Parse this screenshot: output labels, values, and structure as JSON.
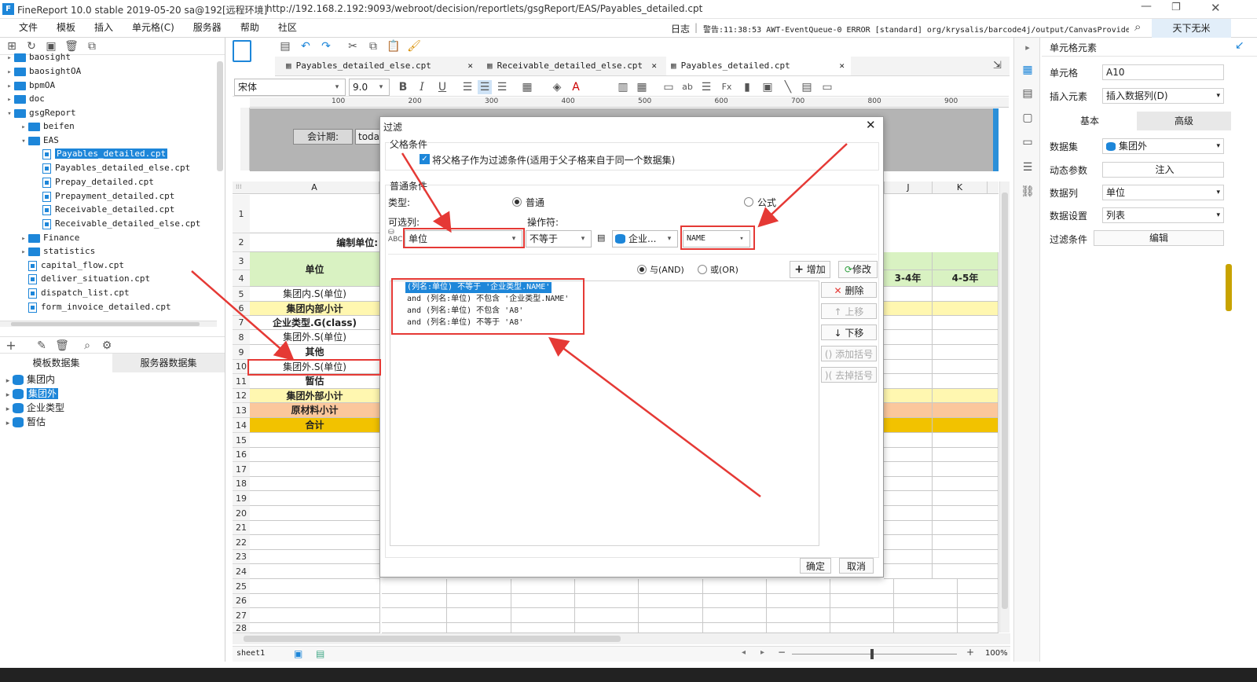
{
  "window": {
    "title": "FineReport 10.0 stable 2019-05-20 sa@192[远程环境]",
    "url": "http://192.168.2.192:9093/webroot/decision/reportlets/gsgReport/EAS/Payables_detailed.cpt",
    "user": "天下无米"
  },
  "menu": [
    "文件",
    "模板",
    "插入",
    "单元格(C)",
    "服务器",
    "帮助",
    "社区"
  ],
  "log": {
    "label": "日志",
    "warning": "警告:11:38:53 AWT-EventQueue-0 ERROR [standard] org/krysalis/barcode4j/output/CanvasProvider"
  },
  "tree": [
    {
      "label": "baosight",
      "type": "folder",
      "depth": 0
    },
    {
      "label": "baosightOA",
      "type": "folder",
      "depth": 0
    },
    {
      "label": "bpmOA",
      "type": "folder",
      "depth": 0
    },
    {
      "label": "doc",
      "type": "folder",
      "depth": 0
    },
    {
      "label": "gsgReport",
      "type": "folder",
      "depth": 0,
      "open": true
    },
    {
      "label": "beifen",
      "type": "folder",
      "depth": 1
    },
    {
      "label": "EAS",
      "type": "folder",
      "depth": 1,
      "open": true
    },
    {
      "label": "Payables_detailed.cpt",
      "type": "file",
      "depth": 2,
      "selected": true
    },
    {
      "label": "Payables_detailed_else.cpt",
      "type": "file",
      "depth": 2
    },
    {
      "label": "Prepay_detailed.cpt",
      "type": "file",
      "depth": 2
    },
    {
      "label": "Prepayment_detailed.cpt",
      "type": "file",
      "depth": 2
    },
    {
      "label": "Receivable_detailed.cpt",
      "type": "file",
      "depth": 2
    },
    {
      "label": "Receivable_detailed_else.cpt",
      "type": "file",
      "depth": 2
    },
    {
      "label": "Finance",
      "type": "folder",
      "depth": 1
    },
    {
      "label": "statistics",
      "type": "folder",
      "depth": 1
    },
    {
      "label": "capital_flow.cpt",
      "type": "file",
      "depth": 1
    },
    {
      "label": "deliver_situation.cpt",
      "type": "file",
      "depth": 1
    },
    {
      "label": "dispatch_list.cpt",
      "type": "file",
      "depth": 1
    },
    {
      "label": "form_invoice_detailed.cpt",
      "type": "file",
      "depth": 1
    }
  ],
  "dataset_tabs": [
    "模板数据集",
    "服务器数据集"
  ],
  "datasets": [
    {
      "label": "集团内"
    },
    {
      "label": "集团外",
      "selected": true
    },
    {
      "label": "企业类型"
    },
    {
      "label": "暂估"
    }
  ],
  "tabs": [
    {
      "label": "Payables_detailed_else.cpt"
    },
    {
      "label": "Receivable_detailed_else.cpt"
    },
    {
      "label": "Payables_detailed.cpt",
      "active": true
    }
  ],
  "format": {
    "font": "宋体",
    "size": "9.0"
  },
  "ruler": [
    "100",
    "200",
    "300",
    "400",
    "500",
    "600",
    "700",
    "800",
    "900"
  ],
  "param": {
    "label": "会计期:",
    "value": "toda"
  },
  "sheet": {
    "col_a": "A",
    "col_j": "J",
    "col_k": "K",
    "rows": [
      "1",
      "2",
      "3",
      "4",
      "5",
      "6",
      "7",
      "8",
      "9",
      "10",
      "11",
      "12",
      "13",
      "14",
      "15",
      "16",
      "17",
      "18",
      "19",
      "20",
      "21",
      "22",
      "23",
      "24",
      "25",
      "26",
      "27",
      "28"
    ],
    "cells": {
      "r2": "编制单位:",
      "unit": "单位",
      "r5": "集团内.S(单位)",
      "r6": "集团内部小计",
      "r7": "企业类型.G(class)",
      "r8": "集团外.S(单位)",
      "r9": "其他",
      "r10": "集团外.S(单位)",
      "r11": "暂估",
      "r12": "集团外部小计",
      "r13": "原材料小计",
      "r14": "合计",
      "j4": "3-4年",
      "k4": "4-5年"
    },
    "tab": "sheet1",
    "zoom": "100%"
  },
  "dialog": {
    "title": "过滤",
    "parent_section": "父格条件",
    "parent_checkbox": "将父格子作为过滤条件(适用于父子格来自于同一个数据集)",
    "normal_section": "普通条件",
    "type_label": "类型:",
    "type_normal": "普通",
    "type_formula": "公式",
    "column_label": "可选列:",
    "operator_label": "操作符:",
    "column_value": "单位",
    "operator_value": "不等于",
    "dataset_value": "企业...",
    "field_value": "NAME",
    "and_label": "与(AND)",
    "or_label": "或(OR)",
    "add": "增加",
    "modify": "修改",
    "conditions": [
      "(列名:单位) 不等于 '企业类型.NAME'",
      "and (列名:单位) 不包含 '企业类型.NAME'",
      "and (列名:单位) 不包含 'A8'",
      "and (列名:单位) 不等于 'A8'"
    ],
    "side_buttons": [
      "删除",
      "上移",
      "下移",
      "添加括号",
      "去掉括号"
    ],
    "ok": "确定",
    "cancel": "取消"
  },
  "props": {
    "title": "单元格元素",
    "cell_label": "单元格",
    "cell_value": "A10",
    "insert_label": "插入元素",
    "insert_value": "插入数据列(D)",
    "tab_basic": "基本",
    "tab_adv": "高级",
    "ds_label": "数据集",
    "ds_value": "集团外",
    "dyn_label": "动态参数",
    "dyn_value": "注入",
    "col_label": "数据列",
    "col_value": "单位",
    "set_label": "数据设置",
    "set_value": "列表",
    "filter_label": "过滤条件",
    "filter_value": "编辑"
  }
}
